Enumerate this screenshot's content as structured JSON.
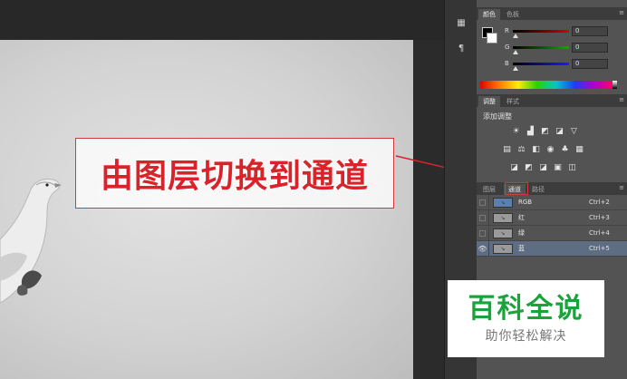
{
  "annotation": {
    "text": "由图层切换到通道"
  },
  "dock": {
    "collapse_label": "◂◂",
    "icons": [
      "color-swatch-icon",
      "paragraph-icon",
      "channels-icon",
      "adjust-icon"
    ]
  },
  "color_panel": {
    "tabs": [
      "颜色",
      "色板"
    ],
    "active_tab": "颜色",
    "channels": [
      {
        "label": "R",
        "value": "0",
        "color": "#d40000"
      },
      {
        "label": "G",
        "value": "0",
        "color": "#00b000"
      },
      {
        "label": "B",
        "value": "0",
        "color": "#1a1aff"
      }
    ],
    "foreground": "#000000",
    "background": "#ffffff"
  },
  "adjustments_panel": {
    "tabs": [
      "调整",
      "样式"
    ],
    "active_tab": "调整",
    "title": "添加调整",
    "icons": [
      [
        "brightness-icon",
        "levels-icon",
        "curves-icon",
        "exposure-icon",
        "triangle-icon"
      ],
      [
        "vibrance-icon",
        "balance-icon",
        "bw-icon",
        "camera-icon",
        "mixer-icon",
        "lookup-icon"
      ],
      [
        "invert-icon",
        "posterize-icon",
        "threshold-icon",
        "gradient-map-icon",
        "selective-color-icon"
      ]
    ]
  },
  "channels_panel": {
    "tabs": [
      "图层",
      "通道",
      "路径"
    ],
    "active_tab": "通道",
    "rows": [
      {
        "name": "RGB",
        "shortcut": "Ctrl+2",
        "selected": false,
        "visible": false
      },
      {
        "name": "红",
        "shortcut": "Ctrl+3",
        "selected": false,
        "visible": false
      },
      {
        "name": "绿",
        "shortcut": "Ctrl+4",
        "selected": false,
        "visible": false
      },
      {
        "name": "蓝",
        "shortcut": "Ctrl+5",
        "selected": true,
        "visible": true
      }
    ],
    "selected_row_color": "#5f6d82"
  },
  "watermark": {
    "main": "百科全说",
    "sub": "助你轻松解决",
    "color": "#1aa33a"
  },
  "colors": {
    "annotation_red": "#d9232a",
    "panel_bg": "#535353",
    "dock_bg": "#353535"
  }
}
